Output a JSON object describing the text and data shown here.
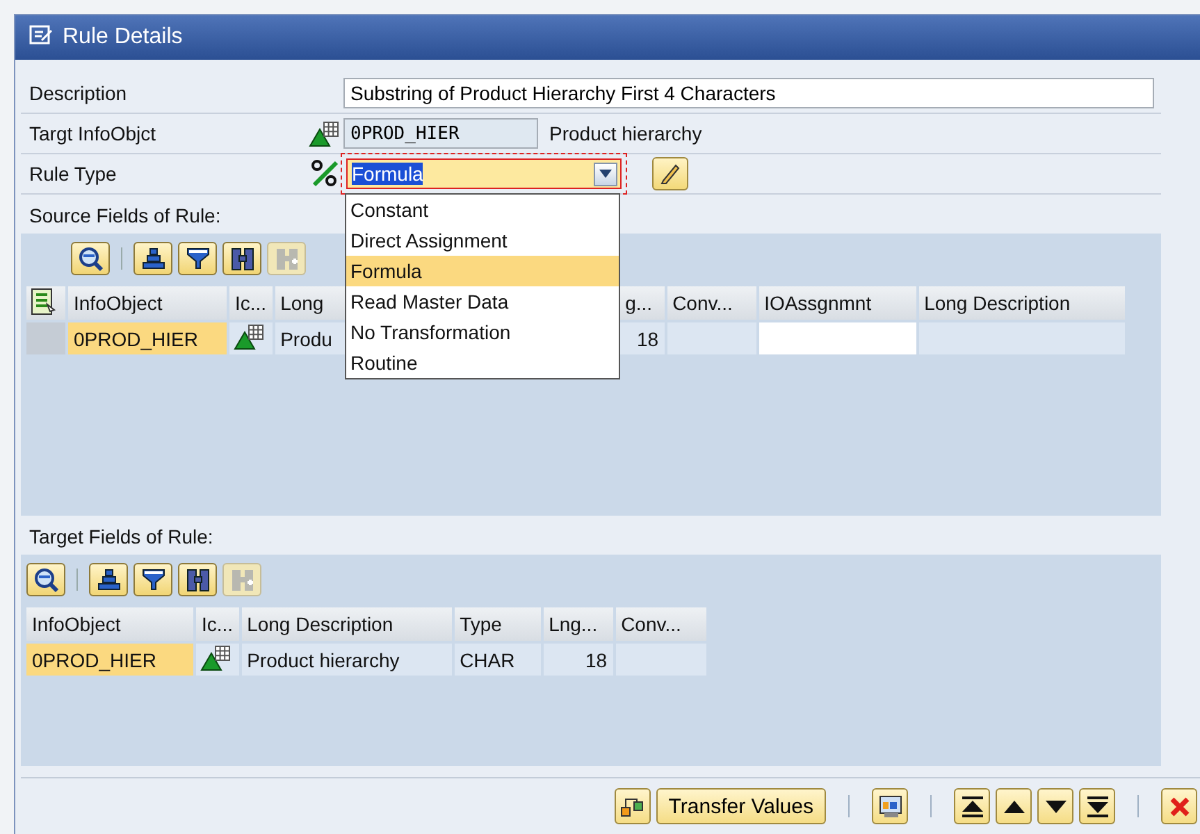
{
  "window": {
    "title": "Rule Details"
  },
  "form": [
    {
      "kind": "text",
      "label": "Description",
      "value": "Substring of Product Hierarchy First 4 Characters"
    },
    {
      "kind": "infoobject",
      "label": "Targt InfoObjct",
      "value": "0PROD_HIER",
      "description": "Product hierarchy"
    },
    {
      "kind": "dropdown",
      "label": "Rule Type",
      "value": "Formula",
      "expanded": true,
      "options": [
        {
          "label": "Constant",
          "selected": false
        },
        {
          "label": "Direct Assignment",
          "selected": false
        },
        {
          "label": "Formula",
          "selected": true
        },
        {
          "label": "Read Master Data",
          "selected": false
        },
        {
          "label": "No Transformation",
          "selected": false
        },
        {
          "label": "Routine",
          "selected": false
        }
      ]
    }
  ],
  "source_fields": {
    "title": "Source Fields of Rule:",
    "toolbar": [
      {
        "kind": "details",
        "disabled": false
      },
      {
        "kind": "sort-ascending",
        "disabled": false
      },
      {
        "kind": "filter",
        "disabled": false
      },
      {
        "kind": "find",
        "disabled": false
      },
      {
        "kind": "find-next",
        "disabled": true
      }
    ],
    "columns": [
      "InfoObject",
      "Ic...",
      "Long",
      "g...",
      "Conv...",
      "IOAssgnmnt",
      "Long Description"
    ],
    "rows": [
      {
        "cells": [
          "0PROD_HIER",
          "",
          "Produ",
          "18",
          "",
          "",
          ""
        ]
      }
    ]
  },
  "target_fields": {
    "title": "Target Fields of Rule:",
    "toolbar": [
      {
        "kind": "details",
        "disabled": false
      },
      {
        "kind": "sort-ascending",
        "disabled": false
      },
      {
        "kind": "filter",
        "disabled": false
      },
      {
        "kind": "find",
        "disabled": false
      },
      {
        "kind": "find-next",
        "disabled": true
      }
    ],
    "columns": [
      "InfoObject",
      "Ic...",
      "Long Description",
      "Type",
      "Lng...",
      "Conv..."
    ],
    "rows": [
      {
        "cells": [
          "0PROD_HIER",
          "",
          "Product hierarchy",
          "CHAR",
          "18",
          ""
        ]
      }
    ]
  },
  "footer": [
    {
      "kind": "transfer-icon"
    },
    {
      "kind": "text",
      "label": "Transfer Values"
    },
    {
      "kind": "separator"
    },
    {
      "kind": "layout"
    },
    {
      "kind": "separator"
    },
    {
      "kind": "first"
    },
    {
      "kind": "previous"
    },
    {
      "kind": "next"
    },
    {
      "kind": "last"
    },
    {
      "kind": "separator"
    },
    {
      "kind": "cancel"
    }
  ]
}
